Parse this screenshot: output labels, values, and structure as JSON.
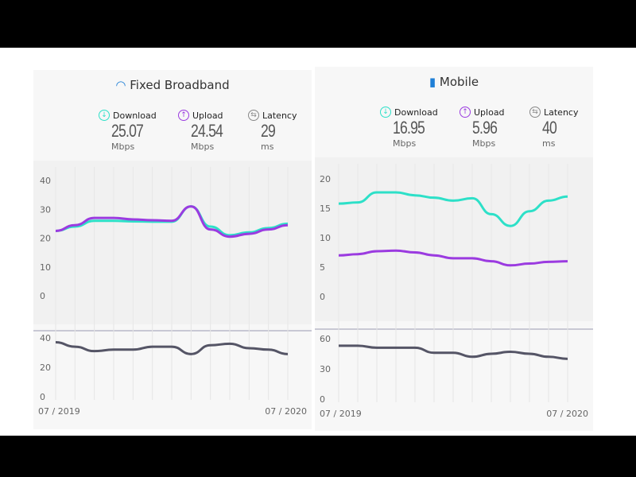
{
  "colors": {
    "download": "#2de0c8",
    "upload": "#9b3be0",
    "latency": "#555566",
    "accent": "#1f7fd6"
  },
  "x_labels": [
    "07 / 2019",
    "07 / 2020"
  ],
  "panels": [
    {
      "title": "Fixed Broadband",
      "icon": "wifi-icon",
      "metrics": [
        {
          "label": "Download",
          "value": "25.07",
          "unit": "Mbps"
        },
        {
          "label": "Upload",
          "value": "24.54",
          "unit": "Mbps"
        },
        {
          "label": "Latency",
          "value": "29",
          "unit": "ms"
        }
      ],
      "speed_ticks": [
        "40",
        "30",
        "20",
        "10",
        "0"
      ],
      "latency_ticks": [
        "40",
        "20",
        "0"
      ],
      "chart_data": {
        "type": "line",
        "x_start": "07 / 2019",
        "x_end": "07 / 2020",
        "speed_ylim": [
          0,
          40
        ],
        "latency_ylim": [
          0,
          40
        ],
        "download": [
          22.5,
          24,
          26,
          26,
          25.8,
          25.7,
          25.7,
          31,
          24,
          21,
          22,
          23.5,
          25
        ],
        "upload": [
          22.5,
          24.5,
          27,
          27,
          26.5,
          26.2,
          26,
          31,
          23,
          20.5,
          21.5,
          23,
          24.5
        ],
        "latency": [
          37,
          34,
          31,
          32,
          32,
          34,
          34,
          29,
          35,
          36,
          33,
          32,
          29
        ]
      }
    },
    {
      "title": "Mobile",
      "icon": "signal-bars-icon",
      "metrics": [
        {
          "label": "Download",
          "value": "16.95",
          "unit": "Mbps"
        },
        {
          "label": "Upload",
          "value": "5.96",
          "unit": "Mbps"
        },
        {
          "label": "Latency",
          "value": "40",
          "unit": "ms"
        }
      ],
      "speed_ticks": [
        "20",
        "15",
        "10",
        "5",
        "0"
      ],
      "latency_ticks": [
        "60",
        "30",
        "0"
      ],
      "chart_data": {
        "type": "line",
        "x_start": "07 / 2019",
        "x_end": "07 / 2020",
        "speed_ylim": [
          0,
          20
        ],
        "latency_ylim": [
          0,
          60
        ],
        "download": [
          15.8,
          16,
          17.7,
          17.7,
          17.2,
          16.8,
          16.3,
          16.7,
          14,
          12,
          14.5,
          16.3,
          17
        ],
        "upload": [
          7,
          7.2,
          7.7,
          7.8,
          7.5,
          7,
          6.5,
          6.5,
          6,
          5.3,
          5.6,
          5.9,
          6
        ],
        "latency": [
          53,
          53,
          51,
          51,
          51,
          46,
          46,
          42,
          45,
          47,
          45,
          42,
          40
        ]
      }
    }
  ]
}
